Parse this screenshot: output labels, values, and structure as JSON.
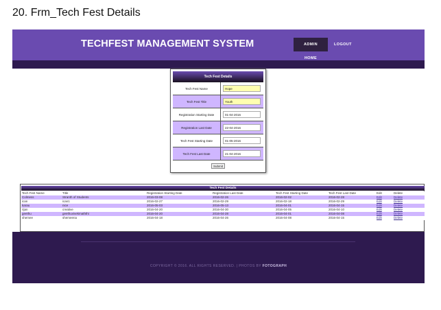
{
  "caption": "20. Frm_Tech Fest Details",
  "header": {
    "brand": "TECHFEST MANAGEMENT SYSTEM",
    "nav_admin_home": "ADMIN HOME",
    "nav_logout": "LOGOUT",
    "brand_color": "#6a4bb0",
    "strip_color": "#2e1a4f"
  },
  "form": {
    "title": "Tech Fest Details",
    "fields": [
      {
        "label": "Tech Fest Name",
        "value": "Hope"
      },
      {
        "label": "Tech Fest Title",
        "value": "Youth"
      },
      {
        "label": "Registration Starting Date",
        "value": "01-04-2016"
      },
      {
        "label": "Registration Last Date",
        "value": "22-04-2016"
      },
      {
        "label": "Tech Fest Starting Date",
        "value": "01-05-2016"
      },
      {
        "label": "Tech Fest Last Date",
        "value": "21-04-2016"
      }
    ],
    "submit_label": "Submit"
  },
  "table": {
    "title": "Tech Fest Details",
    "headers": [
      "Tech Fest Name",
      "Title",
      "Registration Starting Date",
      "Registration Last Date",
      "Tech Fest Starting Date",
      "Tech Fest Last Date",
      "Edit",
      "Delete"
    ],
    "rows": [
      [
        "Colmess",
        "Stranth of Students",
        "2016-03-08",
        "2016-02-26",
        "2016-02-02",
        "2016-02-28",
        "Edit",
        "Delete"
      ],
      [
        "ican",
        "ican1",
        "2016-02-27",
        "2016-02-29",
        "2016-02-18",
        "2016-02-29",
        "Edit",
        "Delete"
      ],
      [
        "karau",
        "nice",
        "2016-05-03",
        "2016-05-13",
        "2016-04-01",
        "2016-04-15",
        "Edit",
        "Delete"
      ],
      [
        "rijan",
        "creative",
        "2016-04-20",
        "2016-04-30",
        "2016-04-05",
        "2016-04-10",
        "Edit",
        "Delete"
      ],
      [
        "geethu",
        "geethuvivekmaththi",
        "2016-04-20",
        "2016-04-28",
        "2016-04-01",
        "2016-04-08",
        "Edit",
        "Delete"
      ],
      [
        "shemee",
        "shemeena",
        "2016-04-18",
        "2016-04-26",
        "2016-04-08",
        "2016-04-15",
        "Edit",
        "Delete"
      ]
    ]
  },
  "footer": {
    "text": "COPYRIGHT © 2016. ALL RIGHTS RESERVED. | PHOTOS BY",
    "credit": "FOTOGRAPH"
  }
}
